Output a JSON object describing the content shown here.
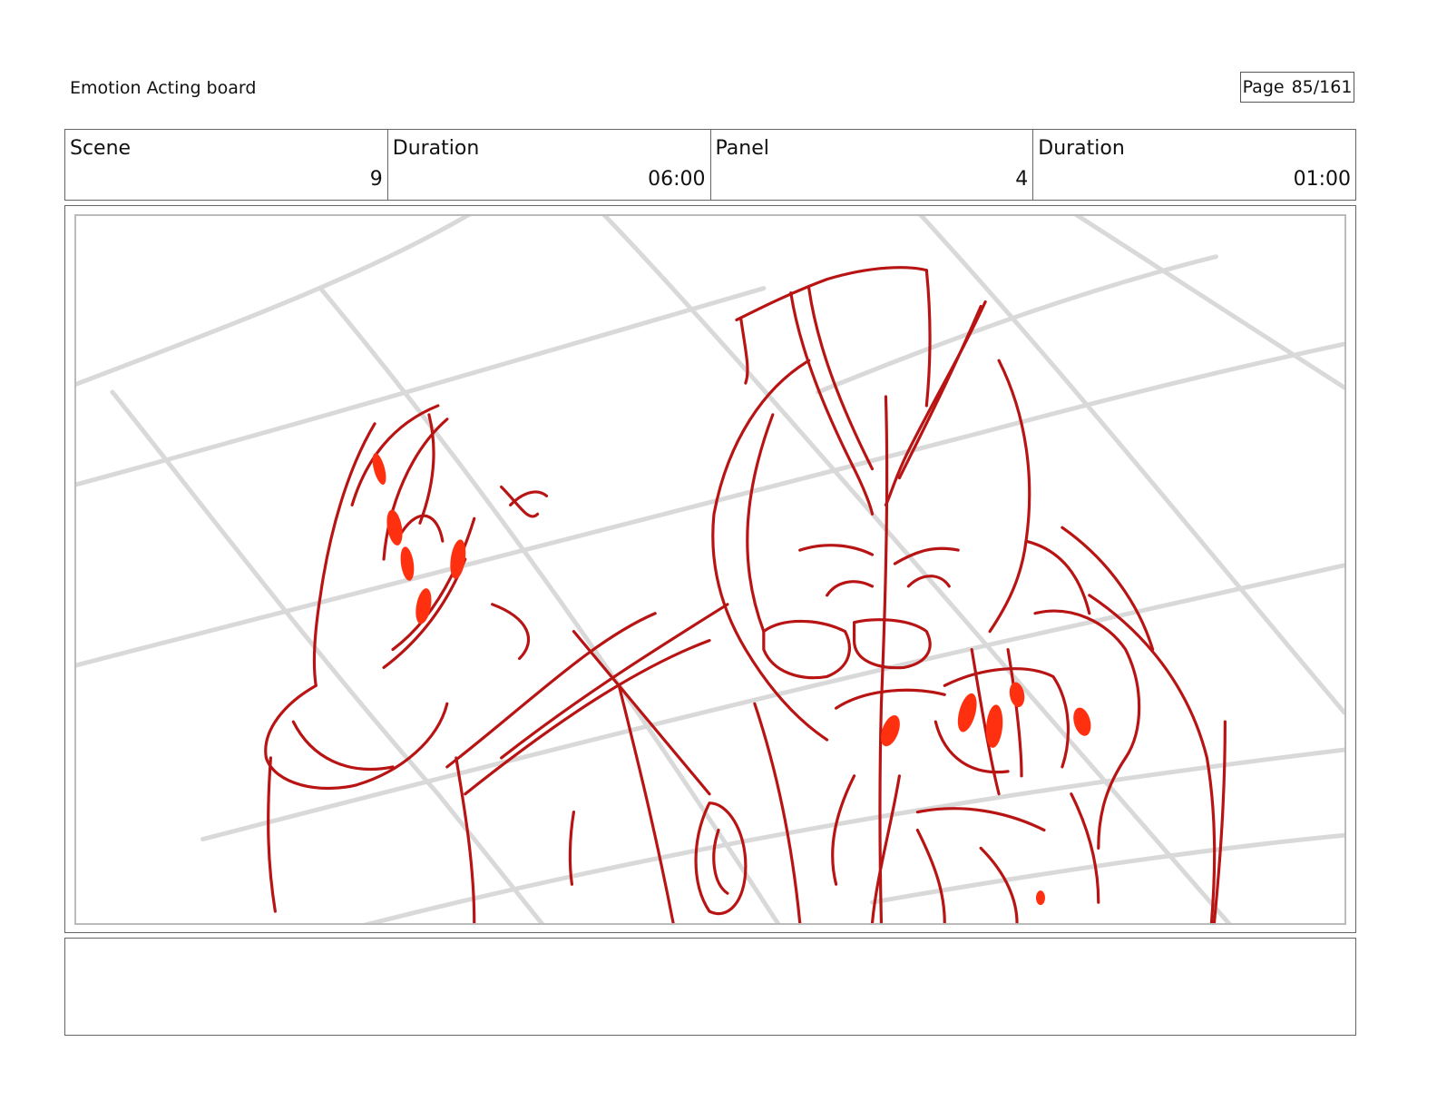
{
  "header": {
    "title": "Emotion Acting board",
    "page_label": "Page",
    "page_number": "85/161"
  },
  "info": {
    "scene_label": "Scene",
    "scene_value": "9",
    "scene_duration_label": "Duration",
    "scene_duration_value": "06:00",
    "panel_label": "Panel",
    "panel_value": "4",
    "panel_duration_label": "Duration",
    "panel_duration_value": "01:00"
  },
  "sketch": {
    "line_color": "#b81414",
    "accent_color": "#ff3010",
    "grid_color": "#d9d9d9"
  },
  "notes": {
    "text": ""
  }
}
